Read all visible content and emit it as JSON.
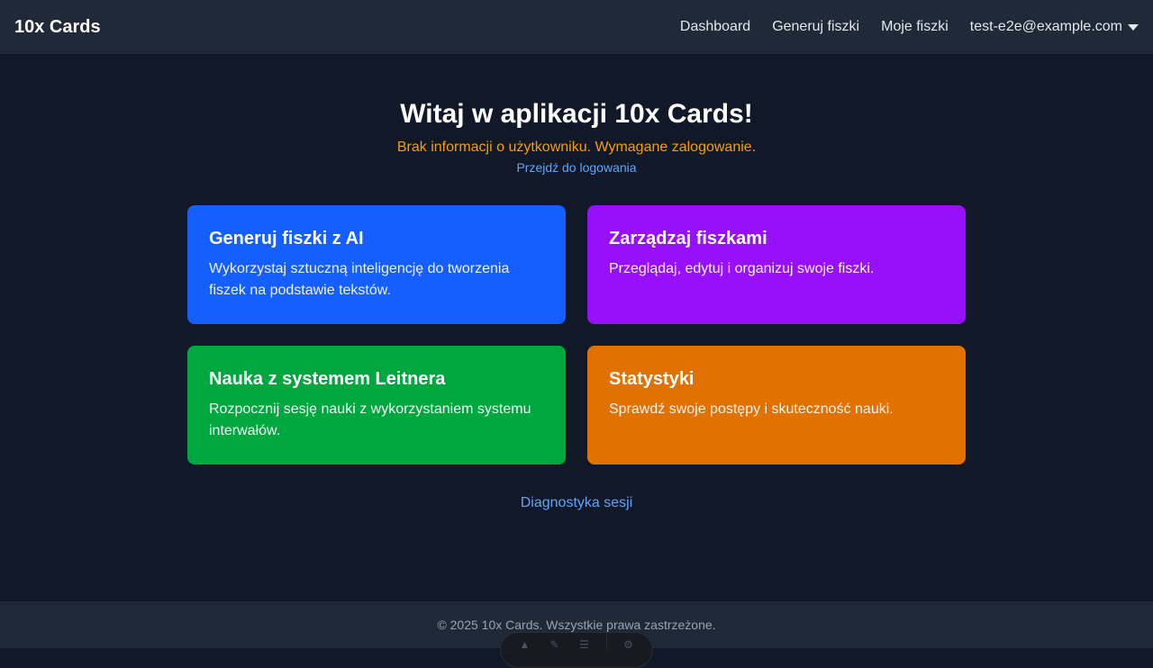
{
  "navbar": {
    "brand": "10x Cards",
    "links": [
      "Dashboard",
      "Generuj fiszki",
      "Moje fiszki"
    ],
    "user_email": "test-e2e@example.com"
  },
  "main": {
    "title": "Witaj w aplikacji 10x Cards!",
    "warning": "Brak informacji o użytkowniku. Wymagane zalogowanie.",
    "login_link": "Przejdź do logowania",
    "cards": [
      {
        "title": "Generuj fiszki z AI",
        "description": "Wykorzystaj sztuczną inteligencję do tworzenia fiszek na podstawie tekstów.",
        "color": "#155eff"
      },
      {
        "title": "Zarządzaj fiszkami",
        "description": "Przeglądaj, edytuj i organizuj swoje fiszki.",
        "color": "#9810fa"
      },
      {
        "title": "Nauka z systemem Leitnera",
        "description": "Rozpocznij sesję nauki z wykorzystaniem systemu interwałów.",
        "color": "#00a63e"
      },
      {
        "title": "Statystyki",
        "description": "Sprawdź swoje postępy i skuteczność nauki.",
        "color": "#e17100"
      }
    ],
    "diagnostics_link": "Diagnostyka sesji"
  },
  "footer": {
    "text": "© 2025 10x Cards. Wszystkie prawa zastrzeżone."
  },
  "colors": {
    "background": "#111827",
    "navbar": "#1f2937",
    "warning": "#f59e0b",
    "link": "#60a5fa"
  },
  "dev_toolbar": {
    "icons": [
      "astro-icon",
      "audit-icon",
      "menu-icon",
      "settings-icon"
    ]
  }
}
